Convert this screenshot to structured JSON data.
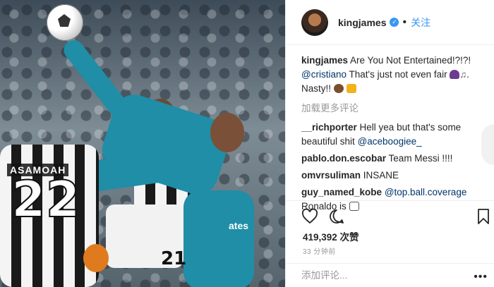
{
  "post": {
    "username": "kingjames",
    "follow_label": "关注",
    "separator": "•"
  },
  "photo": {
    "jersey_name": "ASAMOAH",
    "jersey_number": "22",
    "jersey_number_2": "21",
    "sponsor": "ates"
  },
  "caption": {
    "user": "kingjames",
    "text_1": "Are You Not Entertained!?!?!",
    "mention": "@cristiano",
    "text_2": "That's just not even fair",
    "text_3": ". Nasty!!"
  },
  "load_more_label": "加载更多评论",
  "comments": [
    {
      "user": "__richporter",
      "text": "Hell yea but that's some beautiful shit",
      "mention": "@aceboogiee_",
      "after": ""
    },
    {
      "user": "pablo.don.escobar",
      "text": "Team Messi !!!!",
      "mention": "",
      "after": ""
    },
    {
      "user": "omvrsuliman",
      "text": "INSANE",
      "mention": "",
      "after": ""
    },
    {
      "user": "guy_named_kobe",
      "text": "",
      "mention": "@top.ball.coverage",
      "after": "Ronaldo is"
    }
  ],
  "likes": "419,392 次赞",
  "timestamp": "33 分钟前",
  "add_comment": {
    "placeholder": "添加评论..."
  },
  "more_label": "•••",
  "icons": {
    "like": "heart-icon",
    "comment": "comment-icon",
    "save": "bookmark-icon",
    "verified": "verified-badge-icon",
    "more": "more-options-icon"
  },
  "colors": {
    "link": "#003569",
    "accent": "#3897f0",
    "muted": "#999999",
    "text": "#262626"
  }
}
